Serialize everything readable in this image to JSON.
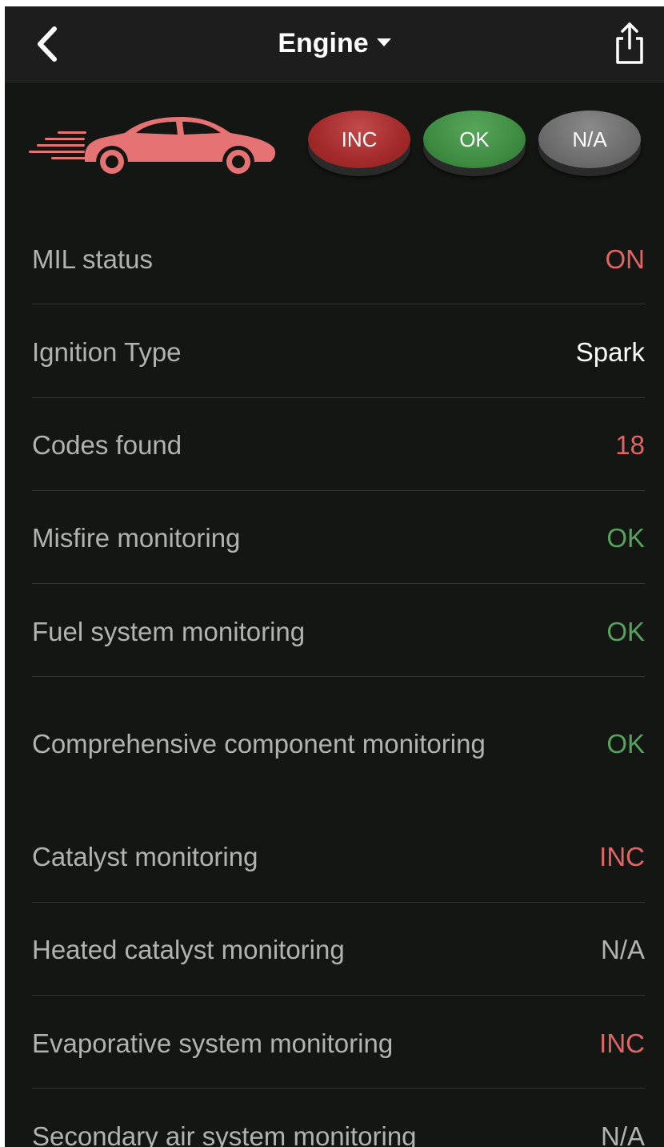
{
  "header": {
    "title": "Engine",
    "back_icon": "chevron-left-icon",
    "share_icon": "share-icon"
  },
  "legend": {
    "inc": "INC",
    "ok": "OK",
    "na": "N/A"
  },
  "colors": {
    "red": "#e26565",
    "green": "#57a35b",
    "white": "#ffffff",
    "gray": "#b0b3b0",
    "car": "#e57373"
  },
  "rows": [
    {
      "label": "MIL status",
      "value": "ON"
    },
    {
      "label": "Ignition Type",
      "value": "Spark"
    },
    {
      "label": "Codes found",
      "value": "18"
    },
    {
      "label": "Misfire monitoring",
      "value": "OK"
    },
    {
      "label": "Fuel system monitoring",
      "value": "OK"
    },
    {
      "label": "Comprehensive component monitoring",
      "value": "OK"
    },
    {
      "label": "Catalyst monitoring",
      "value": "INC"
    },
    {
      "label": "Heated catalyst monitoring",
      "value": "N/A"
    },
    {
      "label": "Evaporative system monitoring",
      "value": "INC"
    },
    {
      "label": "Secondary air system monitoring",
      "value": "N/A"
    }
  ]
}
